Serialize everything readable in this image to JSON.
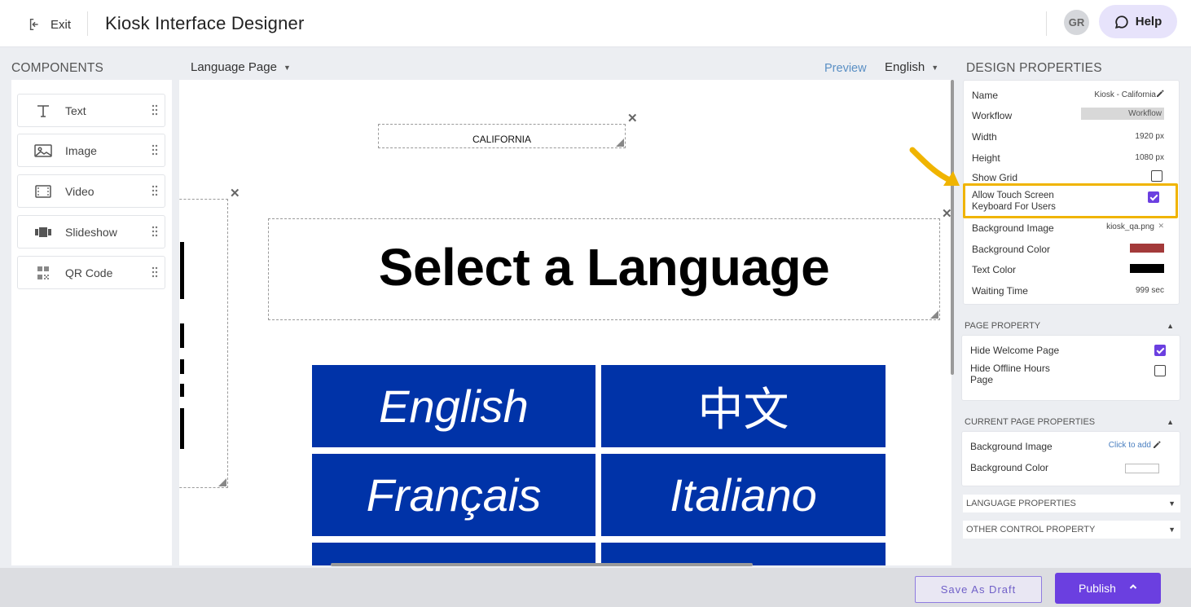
{
  "header": {
    "exit_label": "Exit",
    "title": "Kiosk Interface Designer",
    "avatar_initials": "GR",
    "help_label": "Help"
  },
  "components_panel": {
    "heading": "COMPONENTS",
    "items": [
      {
        "label": "Text",
        "icon": "text-icon"
      },
      {
        "label": "Image",
        "icon": "image-icon"
      },
      {
        "label": "Video",
        "icon": "video-icon"
      },
      {
        "label": "Slideshow",
        "icon": "slideshow-icon"
      },
      {
        "label": "QR Code",
        "icon": "qr-code-icon"
      }
    ]
  },
  "canvas_toolbar": {
    "page_select": "Language Page",
    "preview_label": "Preview",
    "language_select": "English"
  },
  "canvas": {
    "location_label": "CALIFORNIA",
    "title": "Select a Language",
    "languages": [
      "English",
      "中文",
      "Français",
      "Italiano"
    ],
    "button_color": "#0033a8"
  },
  "design_properties": {
    "heading": "DESIGN PROPERTIES",
    "name_label": "Name",
    "name_value": "Kiosk - California",
    "workflow_label": "Workflow",
    "workflow_value": "Workflow",
    "width_label": "Width",
    "width_value": "1920 px",
    "height_label": "Height",
    "height_value": "1080 px",
    "show_grid_label": "Show Grid",
    "show_grid_checked": false,
    "touch_keyboard_label_1": "Allow Touch Screen",
    "touch_keyboard_label_2": "Keyboard For Users",
    "touch_keyboard_checked": true,
    "bg_image_label": "Background Image",
    "bg_image_value": "kiosk_qa.png",
    "bg_color_label": "Background Color",
    "bg_color_value": "#a33a3a",
    "text_color_label": "Text Color",
    "text_color_value": "#000000",
    "waiting_time_label": "Waiting Time",
    "waiting_time_value": "999 sec"
  },
  "page_property": {
    "heading": "PAGE PROPERTY",
    "hide_welcome_label": "Hide Welcome Page",
    "hide_welcome_checked": true,
    "hide_offline_label_1": "Hide Offline Hours",
    "hide_offline_label_2": "Page",
    "hide_offline_checked": false
  },
  "current_page_properties": {
    "heading": "CURRENT PAGE PROPERTIES",
    "bg_image_label": "Background Image",
    "bg_image_action": "Click to add",
    "bg_color_label": "Background Color"
  },
  "collapsed_sections": {
    "language": "LANGUAGE PROPERTIES",
    "other": "OTHER CONTROL PROPERTY"
  },
  "footer": {
    "draft_label": "Save As Draft",
    "publish_label": "Publish"
  },
  "colors": {
    "accent": "#6b3fe0",
    "highlight": "#f0b400"
  }
}
